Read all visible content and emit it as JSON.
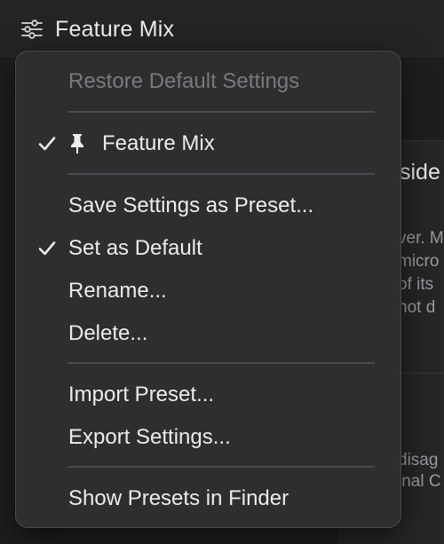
{
  "toolbar": {
    "title": "Feature Mix",
    "icon": "sliders-icon"
  },
  "background": {
    "heading": "side",
    "lines": [
      "ver. M",
      "micro",
      "of its",
      "not d",
      "disag",
      "inal C"
    ]
  },
  "menu": {
    "restore_default": "Restore Default Settings",
    "preset_name": "Feature Mix",
    "save_as_preset": "Save Settings as Preset...",
    "set_as_default": "Set as Default",
    "rename": "Rename...",
    "delete": "Delete...",
    "import_preset": "Import Preset...",
    "export_settings": "Export Settings...",
    "show_in_finder": "Show Presets in Finder"
  },
  "colors": {
    "menu_bg": "#2e2e31",
    "text": "#ececee",
    "disabled_text": "#7a7a7e",
    "separator": "#4b4b4f"
  }
}
